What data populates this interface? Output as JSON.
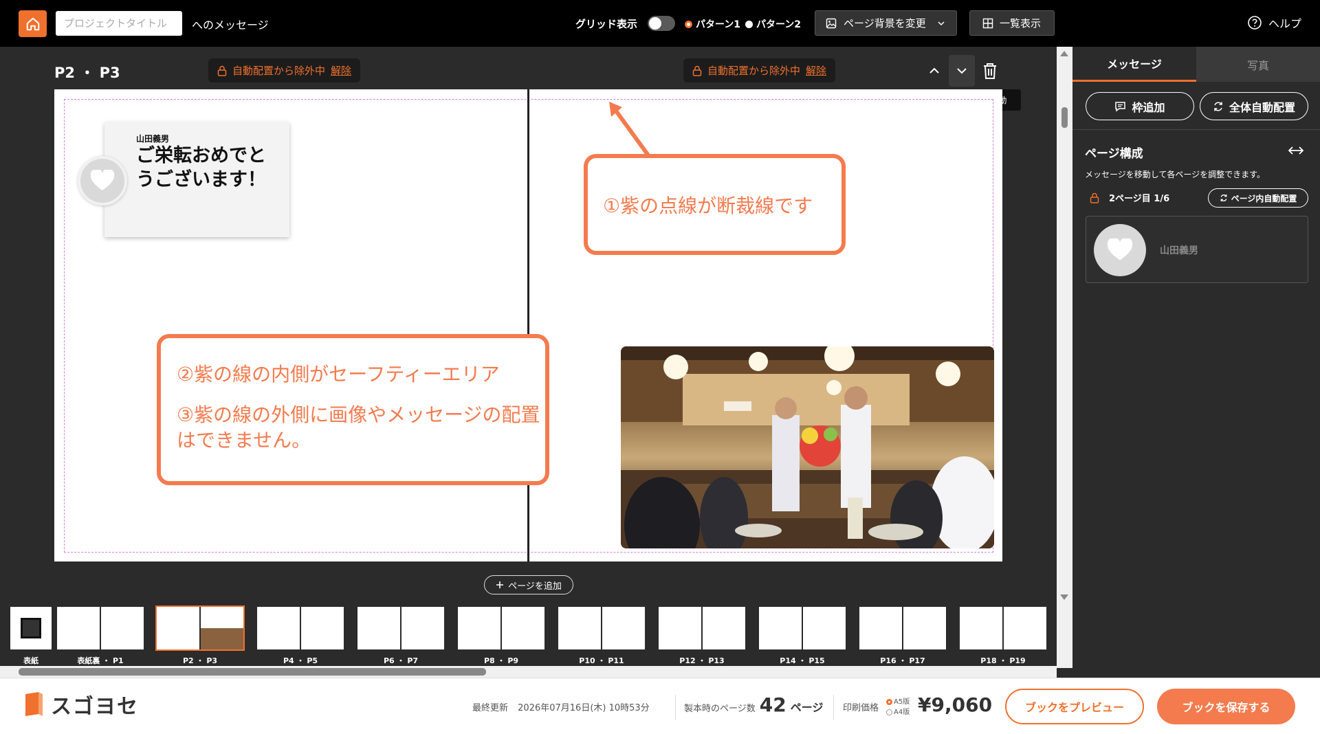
{
  "topbar": {
    "project_title_placeholder": "プロジェクトタイトル",
    "title_suffix": "へのメッセージ",
    "grid_label": "グリッド表示",
    "pattern1": "パターン1",
    "pattern2": "パターン2",
    "bg_change": "ページ背景を変更",
    "list_view": "一覧表示",
    "help": "ヘルプ"
  },
  "editor": {
    "spread_label": "P2 ・ P3",
    "lock_text": "自動配置から除外中",
    "lock_release": "解除",
    "tooltip": "次の見開きページに移動",
    "add_page": "ページを追加"
  },
  "message_card": {
    "name": "山田義男",
    "text": "ご栄転おめでとうございます！"
  },
  "callouts": {
    "c1": "①紫の点線が断裁線です",
    "c2a": "②紫の線の内側がセーフティーエリア",
    "c2b": "③紫の線の外側に画像やメッセージの配置はできません。"
  },
  "thumbnails": [
    {
      "label": "表紙"
    },
    {
      "label": "表紙裏 ・ P1"
    },
    {
      "label": "P2 ・ P3"
    },
    {
      "label": "P4 ・ P5"
    },
    {
      "label": "P6 ・ P7"
    },
    {
      "label": "P8 ・ P9"
    },
    {
      "label": "P10 ・ P11"
    },
    {
      "label": "P12 ・ P13"
    },
    {
      "label": "P14 ・ P15"
    },
    {
      "label": "P16 ・ P17"
    },
    {
      "label": "P18 ・ P19"
    }
  ],
  "panel": {
    "tab_message": "メッセージ",
    "tab_photo": "写真",
    "add_frame": "枠追加",
    "auto_all": "全体自動配置",
    "section_title": "ページ構成",
    "section_desc": "メッセージを移動して各ページを調整できます。",
    "page_info": "2ページ目 1/6",
    "page_auto": "ページ内自動配置",
    "item_name": "山田義男"
  },
  "bottom": {
    "brand": "スゴヨセ",
    "updated_label": "最終更新",
    "updated_value": "2026年07月16日(木) 10時53分",
    "pages_label": "製本時のページ数",
    "pages_value": "42",
    "pages_unit": "ページ",
    "price_label": "印刷価格",
    "size_a5": "A5版",
    "size_a4": "A4版",
    "price": "¥9,060",
    "preview": "ブックをプレビュー",
    "save": "ブックを保存する"
  },
  "colors": {
    "accent": "#f0702d",
    "callout": "#f47b4e",
    "cut_line": "#d77de0"
  }
}
